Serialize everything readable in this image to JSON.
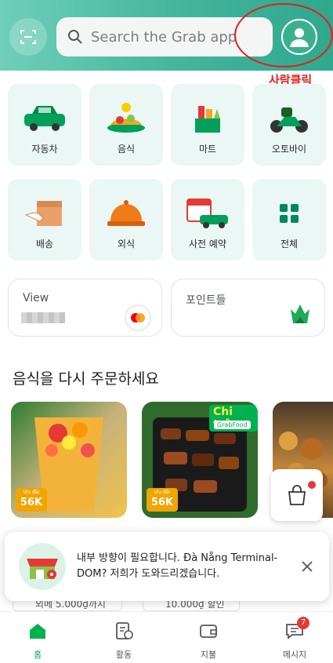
{
  "header": {
    "search_placeholder": "Search the Grab app"
  },
  "annotation": {
    "label": "사람클릭",
    "color": "#e02020"
  },
  "services": [
    {
      "label": "자동차",
      "icon": "car-icon"
    },
    {
      "label": "음식",
      "icon": "food-icon"
    },
    {
      "label": "마트",
      "icon": "grocery-icon"
    },
    {
      "label": "오토바이",
      "icon": "motorbike-icon"
    },
    {
      "label": "배송",
      "icon": "package-icon"
    },
    {
      "label": "외식",
      "icon": "dining-cloche-icon"
    },
    {
      "label": "사전 예약",
      "icon": "calendar-car-icon"
    },
    {
      "label": "전체",
      "icon": "grid-icon"
    }
  ],
  "wallet": {
    "card1_label": "View",
    "card2_label": "포인트들"
  },
  "reorder": {
    "title": "음식을 다시 주문하세요",
    "cards": [
      {
        "deal_small": "Ưu đãi",
        "deal_amount": "56K"
      },
      {
        "deal_small": "Ưu đãi",
        "deal_amount": "56K",
        "banner": "Chi trên",
        "banner_sub": "GrabFood"
      }
    ]
  },
  "toast": {
    "message": "내부 방향이 필요합니다. Đà Nẵng Terminal-DOM? 저희가 도와드리겠습니다."
  },
  "peek_items": [
    "외메 5.000₫까지",
    "10.000₫ 할인"
  ],
  "bottom_nav": [
    {
      "label": "홈",
      "icon": "home-icon",
      "active": true
    },
    {
      "label": "활동",
      "icon": "activity-icon",
      "active": false
    },
    {
      "label": "지불",
      "icon": "wallet-icon",
      "active": false
    },
    {
      "label": "메시지",
      "icon": "chat-icon",
      "active": false,
      "badge": "7"
    }
  ],
  "colors": {
    "brand": "#00b14f",
    "header_start": "#6fcfb9",
    "header_end": "#2fa88d",
    "tile_bg": "#eaf7f4"
  }
}
